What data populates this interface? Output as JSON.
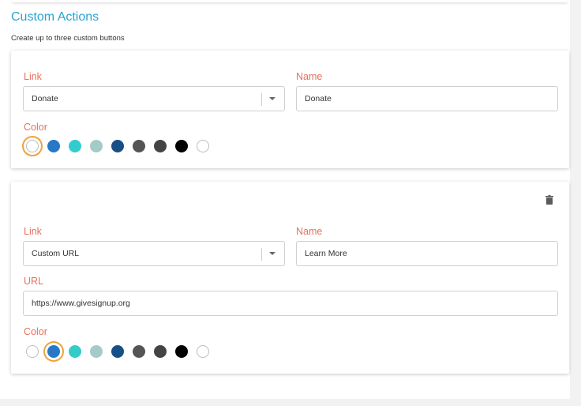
{
  "section": {
    "title": "Custom Actions",
    "subtitle": "Create up to three custom buttons"
  },
  "colors": {
    "accent_title": "#2aa3d0",
    "label": "#e8705c",
    "selected_ring": "#f0a239"
  },
  "palette": [
    "#ffffff",
    "#2878c8",
    "#33cccc",
    "#a4cbc8",
    "#174f86",
    "#555555",
    "#444444",
    "#000000",
    "#ffffff"
  ],
  "card1": {
    "link_label": "Link",
    "link_value": "Donate",
    "name_label": "Name",
    "name_value": "Donate",
    "color_label": "Color",
    "selected_color_index": 0
  },
  "card2": {
    "delete_icon": "trash-icon",
    "link_label": "Link",
    "link_value": "Custom URL",
    "name_label": "Name",
    "name_value": "Learn More",
    "url_label": "URL",
    "url_value": "https://www.givesignup.org",
    "color_label": "Color",
    "selected_color_index": 1
  }
}
